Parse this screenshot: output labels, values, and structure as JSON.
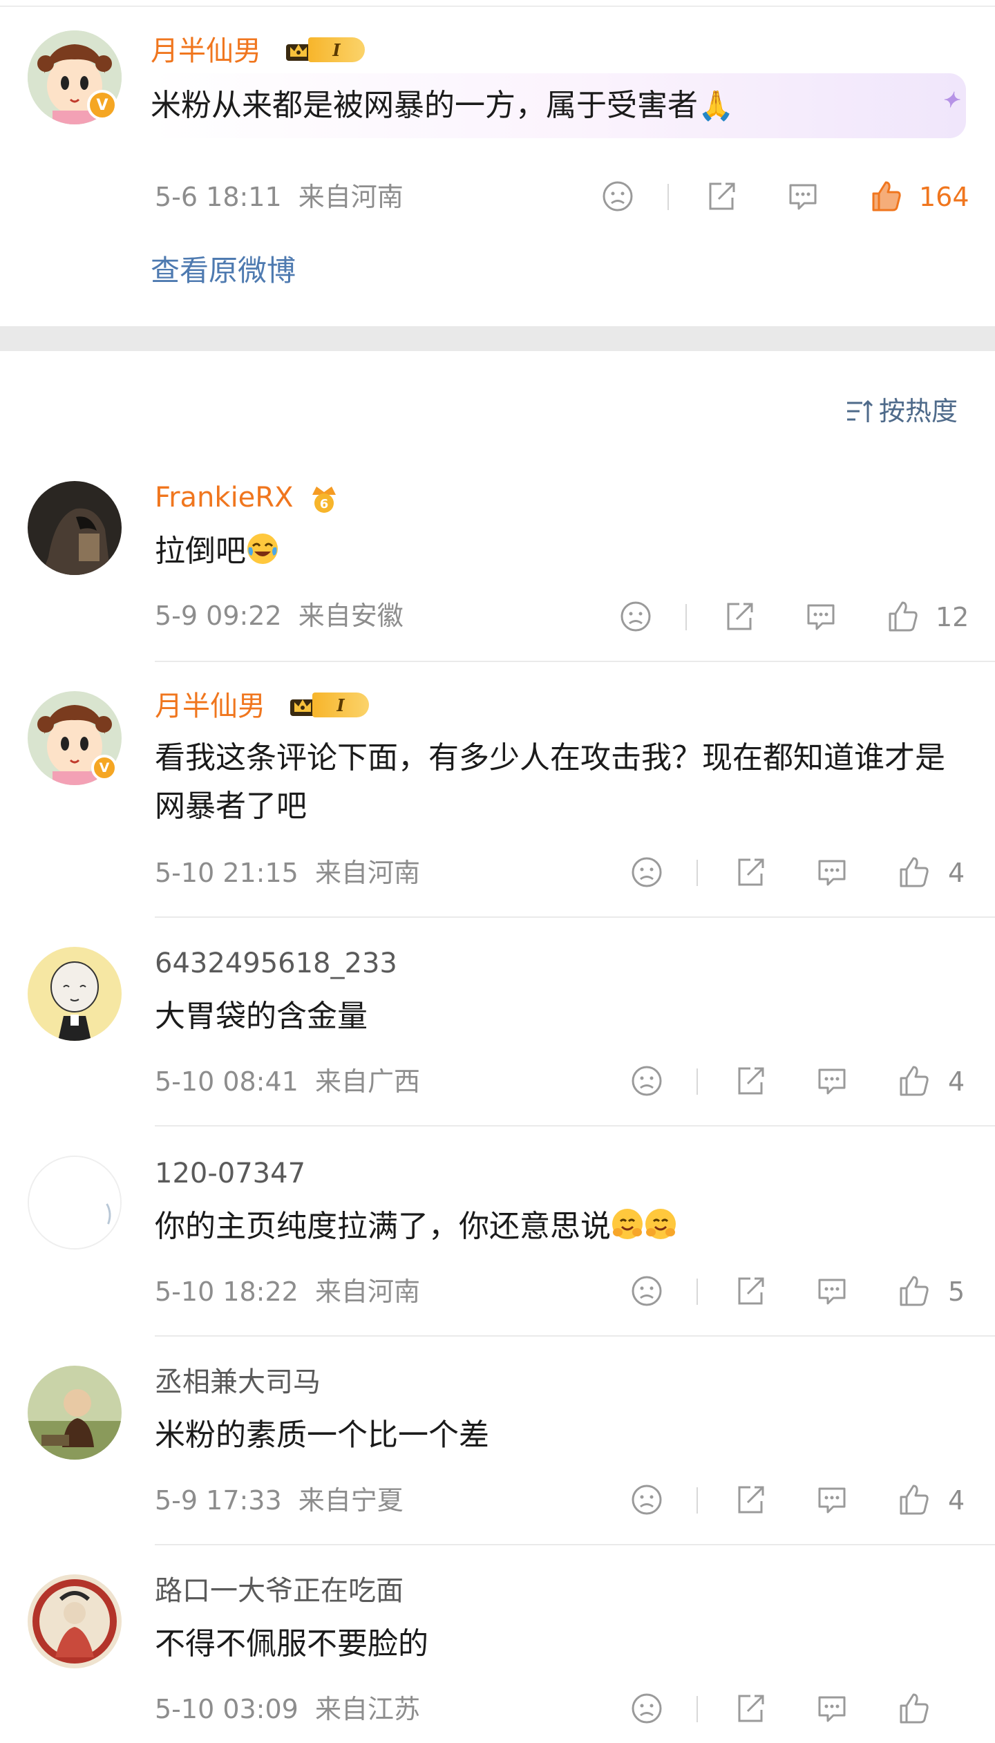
{
  "post": {
    "author": "月半仙男",
    "level": "I",
    "text": "米粉从来都是被网暴的一方，属于受害者",
    "text_emoji": "🙏",
    "time": "5-6 18:11",
    "location": "来自河南",
    "likes": "164",
    "view_original": "查看原微博",
    "verified_badge": "V"
  },
  "sort": {
    "label": "按热度",
    "icon": "sort-icon"
  },
  "comments": [
    {
      "author": "FrankieRX",
      "text": "拉倒吧",
      "emoji": "laughing-crying-emoji",
      "time": "5-9 09:22",
      "location": "来自安徽",
      "likes": "12"
    },
    {
      "author": "月半仙男",
      "level": "I",
      "text": "看我这条评论下面，有多少人在攻击我？现在都知道谁才是网暴者了吧",
      "time": "5-10 21:15",
      "location": "来自河南",
      "likes": "4",
      "verified_badge": "V"
    },
    {
      "author": "6432495618_233",
      "text": "大胃袋的含金量",
      "time": "5-10 08:41",
      "location": "来自广西",
      "likes": "4"
    },
    {
      "author": "120-07347",
      "text": "你的主页纯度拉满了，你还意思说",
      "emoji": "hugging-emoji",
      "time": "5-10 18:22",
      "location": "来自河南",
      "likes": "5"
    },
    {
      "author": "丞相兼大司马",
      "text": "米粉的素质一个比一个差",
      "time": "5-9 17:33",
      "location": "来自宁夏",
      "likes": "4"
    },
    {
      "author": "路口一大爷正在吃面",
      "text": "不得不佩服不要脸的",
      "time": "5-10 03:09",
      "location": "来自江苏",
      "likes": ""
    }
  ],
  "colors": {
    "accent_orange": "#f0761e",
    "link_blue": "#4e7ab0",
    "meta_gray": "#8d8d8d",
    "separator": "#e9e9e9"
  }
}
